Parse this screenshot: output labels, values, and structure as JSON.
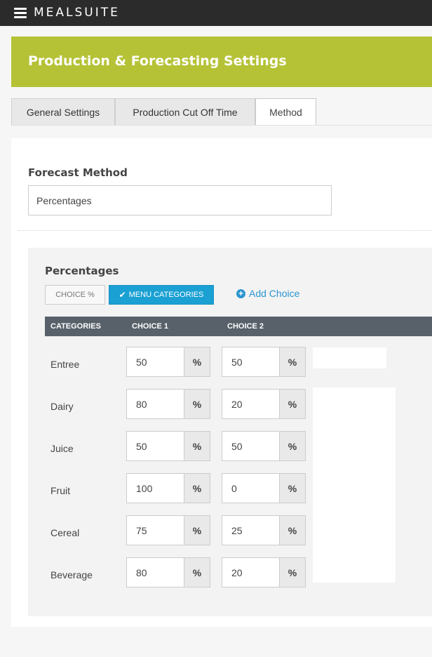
{
  "app": {
    "logo": "MEALSUITE"
  },
  "banner": {
    "title": "Production & Forecasting Settings"
  },
  "tabs": [
    {
      "label": "General Settings"
    },
    {
      "label": "Production Cut Off Time"
    },
    {
      "label": "Method"
    }
  ],
  "forecast": {
    "label": "Forecast Method",
    "value": "Percentages"
  },
  "percentages": {
    "title": "Percentages",
    "choice_pct_label": "CHOICE %",
    "menu_categories_label": "MENU CATEGORIES",
    "add_choice_label": "Add Choice"
  },
  "table": {
    "headers": [
      "CATEGORIES",
      "CHOICE 1",
      "CHOICE 2"
    ],
    "rows": [
      {
        "category": "Entree",
        "choice1": "50",
        "choice2": "50"
      },
      {
        "category": "Dairy",
        "choice1": "80",
        "choice2": "20"
      },
      {
        "category": "Juice",
        "choice1": "50",
        "choice2": "50"
      },
      {
        "category": "Fruit",
        "choice1": "100",
        "choice2": "0"
      },
      {
        "category": "Cereal",
        "choice1": "75",
        "choice2": "25"
      },
      {
        "category": "Beverage",
        "choice1": "80",
        "choice2": "20"
      }
    ]
  },
  "icons": {
    "menu": "hamburger-icon",
    "check": "check-icon",
    "add": "plus-circle-icon",
    "percent": "percent-icon"
  },
  "colors": {
    "topbar": "#2b2b2b",
    "banner": "#b5c236",
    "primary_button": "#1aa0d3",
    "link": "#2b95cf",
    "table_header": "#58616a"
  }
}
